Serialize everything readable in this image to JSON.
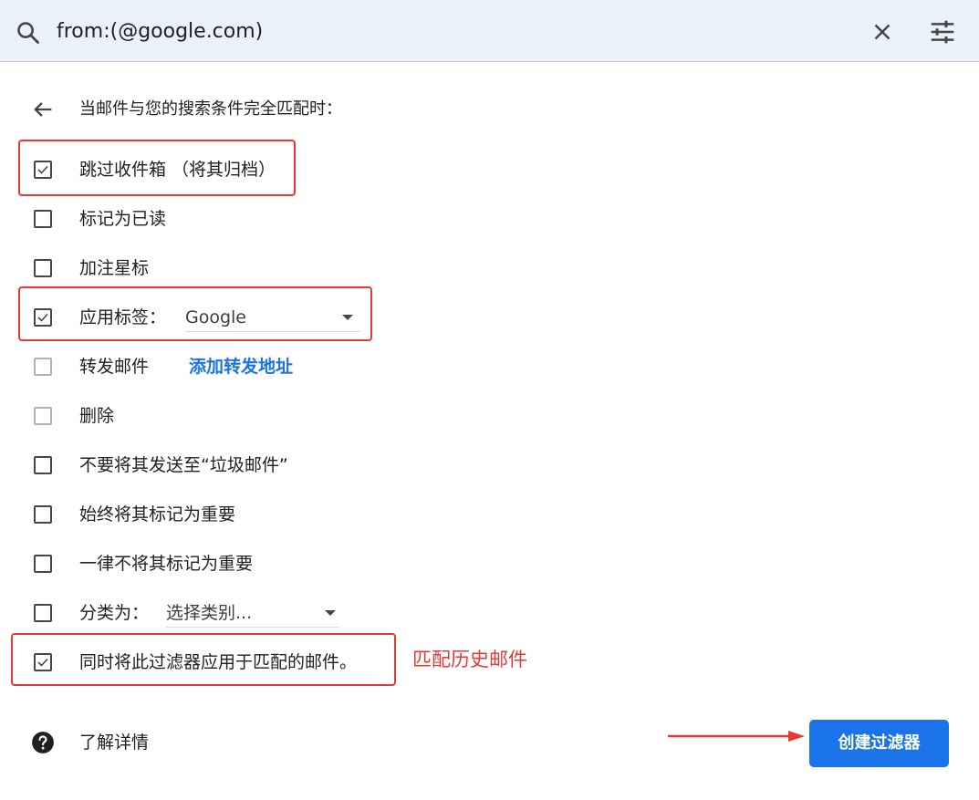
{
  "search": {
    "query": "from:(@google.com)",
    "search_icon": "search-icon",
    "clear_icon": "close-icon",
    "options_icon": "tune-icon"
  },
  "filter": {
    "heading": "当邮件与您的搜索条件完全匹配时：",
    "back_icon": "arrow-back-icon",
    "options": [
      {
        "label": "跳过收件箱 （将其归档）",
        "checked": true,
        "disabled": false
      },
      {
        "label": "标记为已读",
        "checked": false,
        "disabled": false
      },
      {
        "label": "加注星标",
        "checked": false,
        "disabled": false
      },
      {
        "label": "应用标签：",
        "checked": true,
        "disabled": false,
        "select_value": "Google"
      },
      {
        "label": "转发邮件",
        "checked": false,
        "disabled": true,
        "link": "添加转发地址"
      },
      {
        "label": "删除",
        "checked": false,
        "disabled": true
      },
      {
        "label": "不要将其发送至“垃圾邮件”",
        "checked": false,
        "disabled": false
      },
      {
        "label": "始终将其标记为重要",
        "checked": false,
        "disabled": false
      },
      {
        "label": "一律不将其标记为重要",
        "checked": false,
        "disabled": false
      },
      {
        "label": "分类为：",
        "checked": false,
        "disabled": false,
        "select_value": "选择类别..."
      },
      {
        "label": "同时将此过滤器应用于匹配的邮件。",
        "checked": true,
        "disabled": false
      }
    ]
  },
  "annotation": {
    "text": "匹配历史邮件",
    "color": "#e53935"
  },
  "footer": {
    "learn_more": "了解详情",
    "help_icon": "help-icon",
    "create_button": "创建过滤器"
  },
  "colors": {
    "accent": "#1a73e8",
    "search_bg": "#eaf1fb",
    "highlight": "#e53935"
  }
}
